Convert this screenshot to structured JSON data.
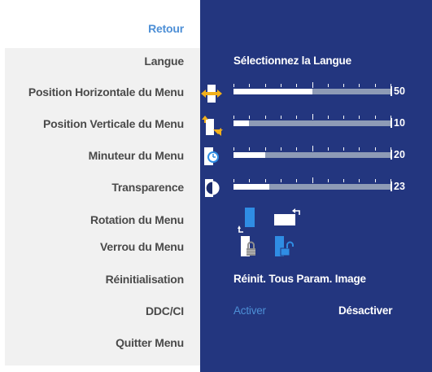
{
  "menu": {
    "items": [
      {
        "label": "Retour",
        "selected": true
      },
      {
        "label": "Langue"
      },
      {
        "label": "Position Horizontale du Menu"
      },
      {
        "label": "Position Verticale du Menu"
      },
      {
        "label": "Minuteur du Menu"
      },
      {
        "label": "Transparence"
      },
      {
        "label": "Rotation du Menu"
      },
      {
        "label": "Verrou du Menu"
      },
      {
        "label": "Réinitialisation"
      },
      {
        "label": "DDC/CI"
      },
      {
        "label": "Quitter Menu"
      }
    ]
  },
  "panel": {
    "langue_value": "Sélectionnez la Langue",
    "sliders": [
      {
        "name": "horizontal-position",
        "value": "50",
        "level": 0.5,
        "icon": "horizontal-position-icon"
      },
      {
        "name": "vertical-position",
        "value": "10",
        "level": 0.1,
        "icon": "vertical-position-icon"
      },
      {
        "name": "menu-timer",
        "value": "20",
        "level": 0.2,
        "icon": "timer-icon"
      },
      {
        "name": "transparency",
        "value": "23",
        "level": 0.23,
        "icon": "transparency-icon"
      }
    ],
    "rotation_icons": [
      "portrait-rotation-icon",
      "landscape-rotation-icon"
    ],
    "lock_icons": [
      "locked-icon",
      "unlocked-icon"
    ],
    "reset_value": "Réinit. Tous Param. Image",
    "ddcci": {
      "enable": "Activer",
      "disable": "Désactiver",
      "selected": "Activer"
    }
  },
  "colors": {
    "panel_bg": "#23367f",
    "menu_bg": "#f1f1f1",
    "selected_text": "#4d8fd6",
    "menu_text": "#4a4a4a",
    "accent_icon": "#2f8de4",
    "icon_arrow": "#f2b01a"
  }
}
